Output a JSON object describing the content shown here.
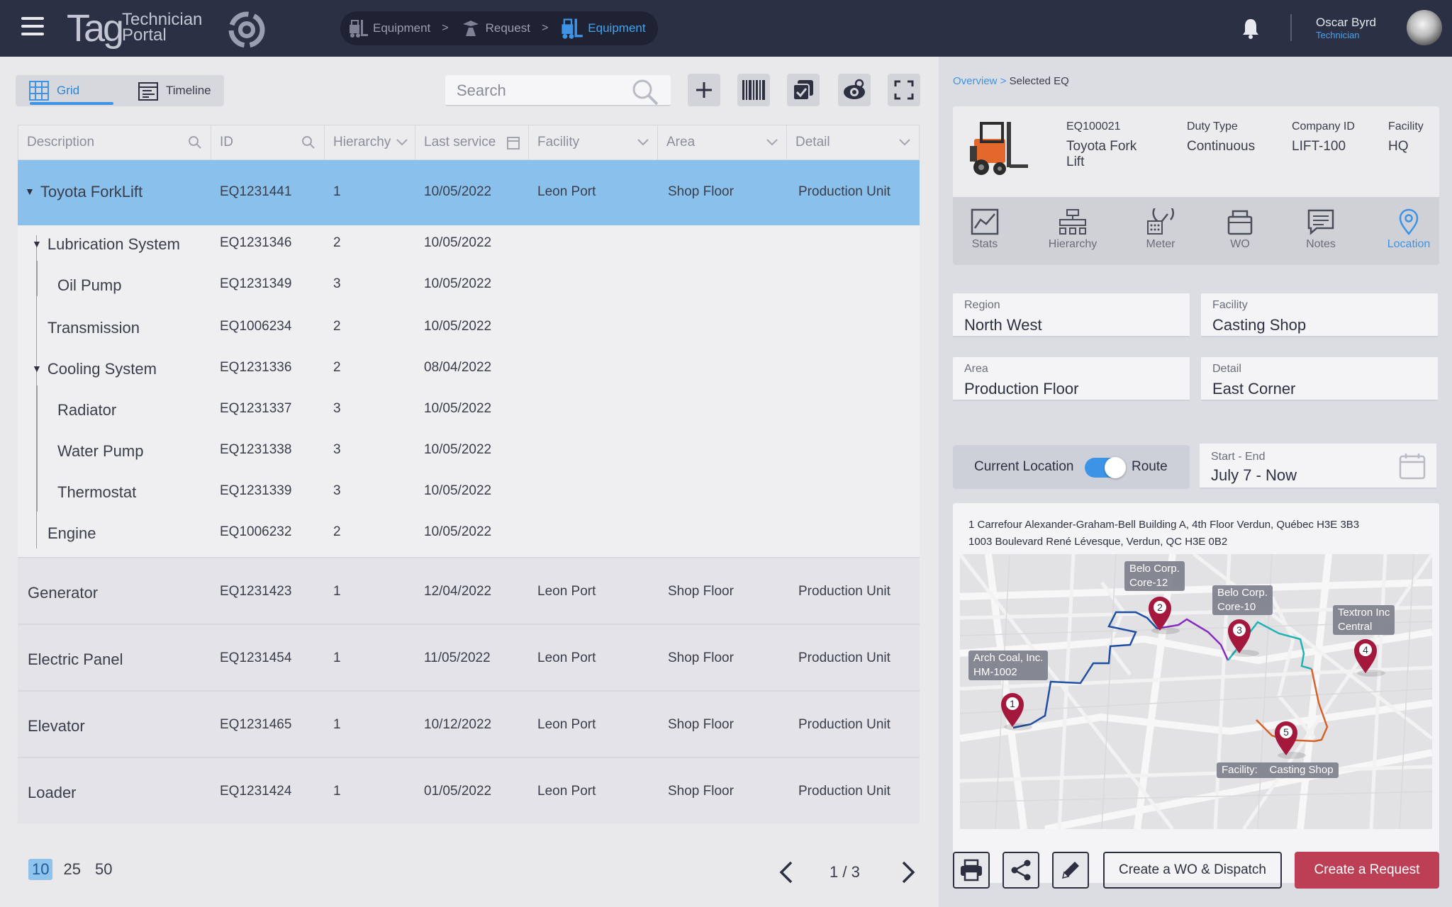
{
  "header": {
    "logo_main": "Tag",
    "logo_sub_1": "Technician",
    "logo_sub_2": "Portal",
    "breadcrumbs": [
      {
        "label": "Equipment",
        "icon": "forklift-icon"
      },
      {
        "label": "Request",
        "icon": "request-icon"
      },
      {
        "label": "Equipment",
        "icon": "forklift-icon",
        "active": true
      }
    ],
    "separator": ">",
    "user": {
      "name": "Oscar Byrd",
      "role": "Technician"
    }
  },
  "view_toggle": {
    "grid": "Grid",
    "timeline": "Timeline",
    "active": "grid"
  },
  "search": {
    "placeholder": "Search"
  },
  "toolbar": {
    "icons": [
      "plus-icon",
      "barcode-icon",
      "checklist-icon",
      "camera-icon",
      "fullscreen-icon"
    ]
  },
  "grid": {
    "columns": [
      "Description",
      "ID",
      "Hierarchy",
      "Last service",
      "Facility",
      "Area",
      "Detail"
    ],
    "rows": [
      {
        "desc": "Toyota ForkLift",
        "id": "EQ1231441",
        "hier": "1",
        "last": "10/05/2022",
        "facility": "Leon Port",
        "area": "Shop Floor",
        "detail": "Production Unit",
        "expanded": true,
        "selected": true
      },
      {
        "desc": "Lubrication System",
        "id": "EQ1231346",
        "hier": "2",
        "last": "10/05/2022",
        "expanded": true
      },
      {
        "desc": "Oil Pump",
        "id": "EQ1231349",
        "hier": "3",
        "last": "10/05/2022"
      },
      {
        "desc": "Transmission",
        "id": "EQ1006234",
        "hier": "2",
        "last": "10/05/2022"
      },
      {
        "desc": "Cooling System",
        "id": "EQ1231336",
        "hier": "2",
        "last": "08/04/2022",
        "expanded": true
      },
      {
        "desc": "Radiator",
        "id": "EQ1231337",
        "hier": "3",
        "last": "10/05/2022"
      },
      {
        "desc": "Water Pump",
        "id": "EQ1231338",
        "hier": "3",
        "last": "10/05/2022"
      },
      {
        "desc": "Thermostat",
        "id": "EQ1231339",
        "hier": "3",
        "last": "10/05/2022"
      },
      {
        "desc": "Engine",
        "id": "EQ1006232",
        "hier": "2",
        "last": "10/05/2022"
      },
      {
        "desc": "Generator",
        "id": "EQ1231423",
        "hier": "1",
        "last": "12/04/2022",
        "facility": "Leon Port",
        "area": "Shop Floor",
        "detail": "Production Unit"
      },
      {
        "desc": "Electric Panel",
        "id": "EQ1231454",
        "hier": "1",
        "last": "11/05/2022",
        "facility": "Leon Port",
        "area": "Shop Floor",
        "detail": "Production Unit"
      },
      {
        "desc": "Elevator",
        "id": "EQ1231465",
        "hier": "1",
        "last": "10/12/2022",
        "facility": "Leon Port",
        "area": "Shop Floor",
        "detail": "Production Unit"
      },
      {
        "desc": "Loader",
        "id": "EQ1231424",
        "hier": "1",
        "last": "01/05/2022",
        "facility": "Leon Port",
        "area": "Shop Floor",
        "detail": "Production Unit"
      }
    ]
  },
  "pagination": {
    "sizes": [
      "10",
      "25",
      "50"
    ],
    "active_size": "10",
    "page_text": "1 / 3"
  },
  "detail": {
    "breadcrumb_link": "Overview",
    "breadcrumb_sep": " > ",
    "breadcrumb_current": "Selected EQ",
    "equipment": {
      "id": "EQ100021",
      "name": "Toyota  Fork Lift",
      "duty_label": "Duty Type",
      "duty_value": "Continuous",
      "company_label": "Company ID",
      "company_value": "LIFT-100",
      "facility_label": "Facility",
      "facility_value": "HQ"
    },
    "tabs": [
      "Stats",
      "Hierarchy",
      "Meter",
      "WO",
      "Notes",
      "Location"
    ],
    "active_tab": "Location",
    "fields": {
      "region_label": "Region",
      "region_value": "North West",
      "facility_label": "Facility",
      "facility_value": "Casting Shop",
      "area_label": "Area",
      "area_value": "Production Floor",
      "detail_label": "Detail",
      "detail_value": "East Corner"
    },
    "location_toggle": {
      "left": "Current Location",
      "right": "Route",
      "on": true
    },
    "date": {
      "label": "Start - End",
      "value": "July 7 - Now"
    },
    "addresses": [
      "1 Carrefour Alexander-Graham-Bell Building A, 4th Floor Verdun, Québec H3E 3B3",
      "1003 Boulevard René Lévesque, Verdun, QC H3E 0B2"
    ],
    "map_pins": [
      {
        "num": "1",
        "label_1": "Arch Coal, Inc.",
        "label_2": "HM-1002"
      },
      {
        "num": "2",
        "label_1": "Belo Corp.",
        "label_2": "Core-12"
      },
      {
        "num": "3",
        "label_1": "Belo Corp.",
        "label_2": "Core-10"
      },
      {
        "num": "4",
        "label_1": "Textron Inc",
        "label_2": "Central"
      },
      {
        "num": "5",
        "label_1": "Facility:",
        "label_2": "Casting Shop"
      }
    ],
    "route_colors": [
      "#1f4fa3",
      "#8a2bc0",
      "#1fb3b3",
      "#d5622b"
    ],
    "actions": {
      "create_wo": "Create a WO & Dispatch",
      "create_request": "Create a Request",
      "icons": [
        "printer-icon",
        "share-icon",
        "edit-icon"
      ]
    }
  }
}
